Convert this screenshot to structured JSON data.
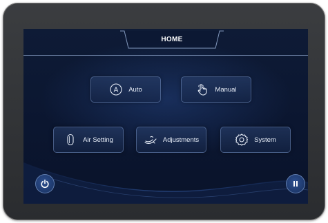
{
  "header": {
    "title": "HOME"
  },
  "menu": {
    "auto": {
      "label": "Auto",
      "icon": "auto-a-icon"
    },
    "manual": {
      "label": "Manual",
      "icon": "hand-pointer-icon"
    },
    "air_setting": {
      "label": "Air Setting",
      "icon": "air-tube-icon"
    },
    "adjustments": {
      "label": "Adjustments",
      "icon": "seat-recline-icon"
    },
    "system": {
      "label": "System",
      "icon": "gear-icon"
    }
  },
  "footer": {
    "power_icon": "power-icon",
    "pause_icon": "pause-icon"
  },
  "colors": {
    "screen_background": "#0b1630",
    "accent": "#2d4f8f",
    "text": "#e8eef8"
  }
}
